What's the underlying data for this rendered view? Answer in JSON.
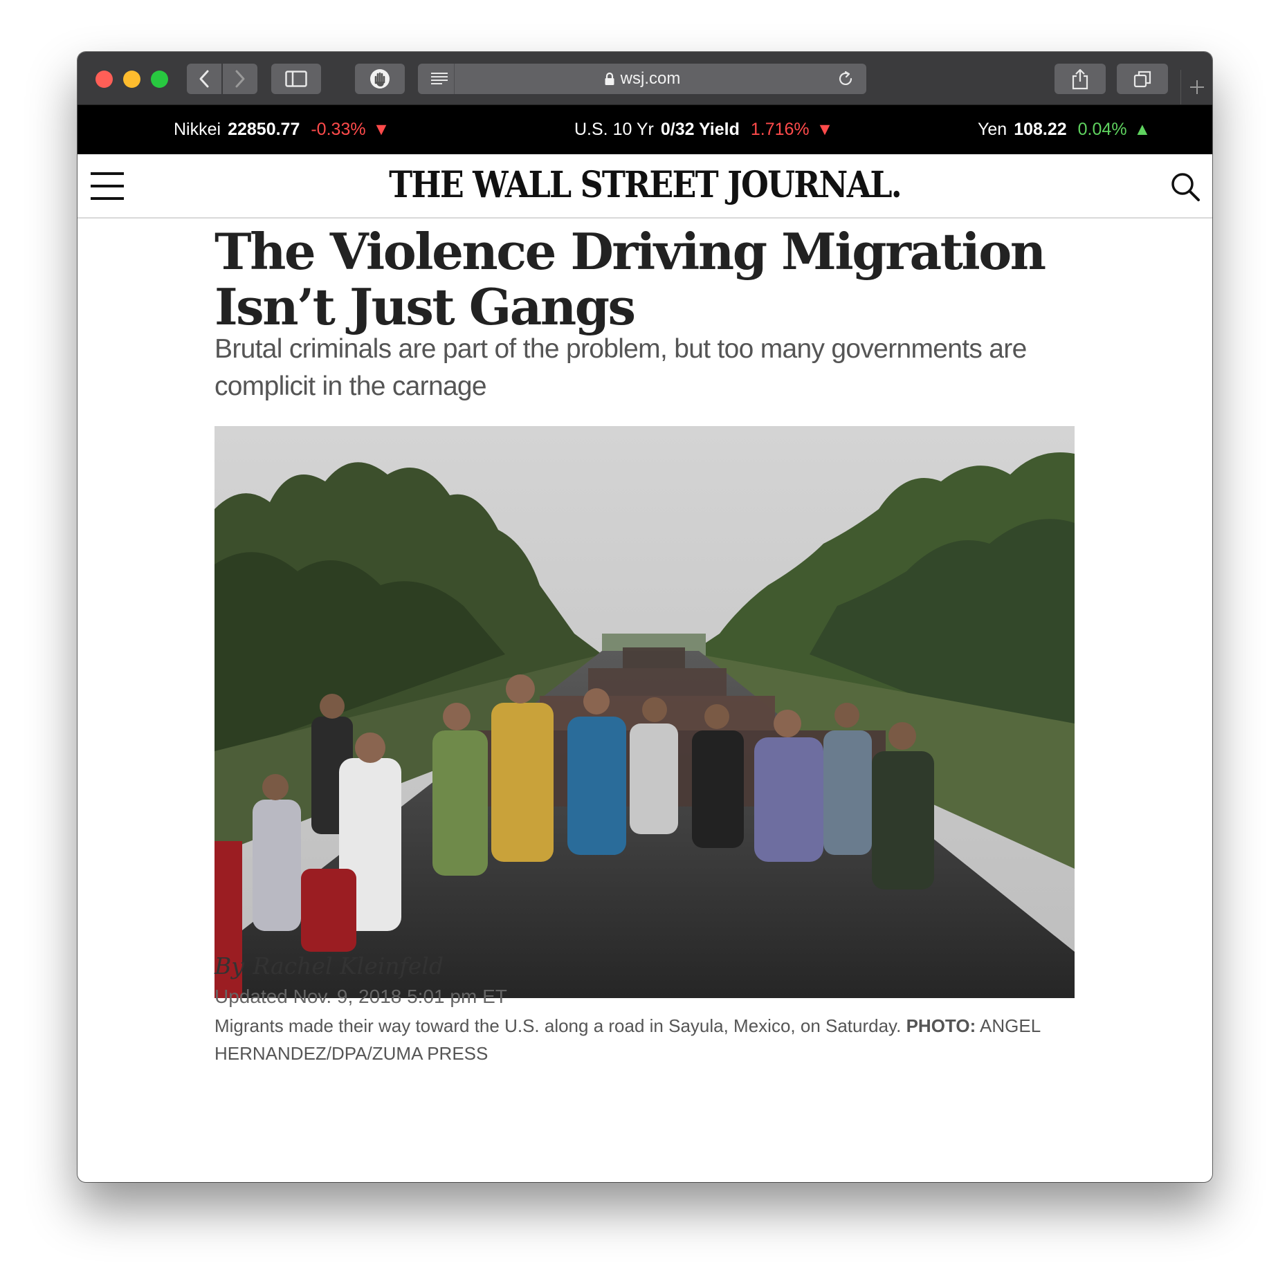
{
  "browser": {
    "url": "wsj.com",
    "icons": {
      "back": "chevron-left-icon",
      "forward": "chevron-right-icon",
      "sidebar": "sidebar-icon",
      "extension": "hand-icon",
      "reader": "reader-icon",
      "lock": "lock-icon",
      "reload": "reload-icon",
      "share": "share-icon",
      "tabs": "tabs-icon",
      "new_tab": "plus-icon"
    }
  },
  "ticker": [
    {
      "name": "Nikkei",
      "value": "22850.77",
      "change": "-0.33%",
      "direction": "down",
      "arrow": "▼"
    },
    {
      "name": "U.S. 10 Yr",
      "value": "0/32 Yield",
      "change": "1.716%",
      "direction": "down",
      "arrow": "▼"
    },
    {
      "name": "Yen",
      "value": "108.22",
      "change": "0.04%",
      "direction": "up",
      "arrow": "▲"
    }
  ],
  "header": {
    "masthead": "THE WALL STREET JOURNAL."
  },
  "article": {
    "headline": "The Violence Driving Migration Isn’t Just Gangs",
    "dek": "Brutal criminals are part of the problem, but too many governments are complicit in the carnage",
    "caption": "Migrants made their way toward the U.S. along a road in Sayula, Mexico, on Saturday.",
    "credit_label": "PHOTO:",
    "credit": "ANGEL HERNANDEZ/DPA/ZUMA PRESS",
    "byline_prefix": "By",
    "author": "Rachel Kleinfeld",
    "updated": "Updated Nov. 9, 2018 5:01 pm ET"
  },
  "colors": {
    "toolbar": "#3b3b3d",
    "ticker_bg": "#000000",
    "down": "#ff4b4b",
    "up": "#5fd35f",
    "headline": "#222222"
  }
}
